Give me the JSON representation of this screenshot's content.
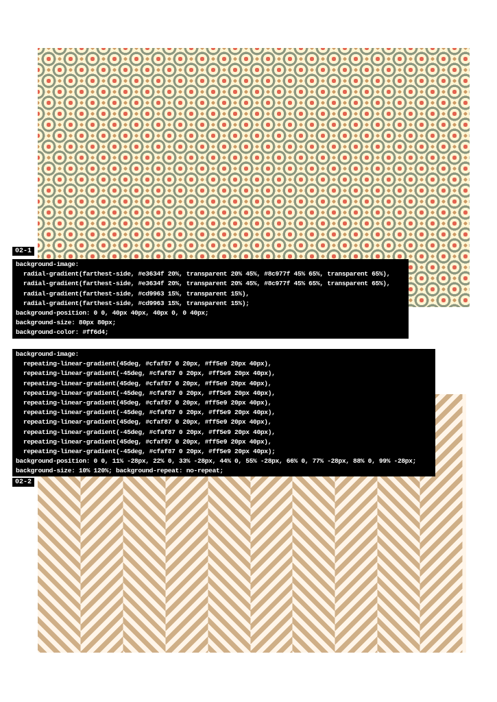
{
  "sections": [
    {
      "label": "02-1",
      "code_lines": [
        "background-image:",
        "  radial-gradient(farthest-side, #e3634f 20%, transparent 20% 45%, #8c977f 45% 65%, transparent 65%),",
        "  radial-gradient(farthest-side, #e3634f 20%, transparent 20% 45%, #8c977f 45% 65%, transparent 65%),",
        "  radial-gradient(farthest-side, #cd9963 15%, transparent 15%),",
        "  radial-gradient(farthest-side, #cd9963 15%, transparent 15%);",
        "background-position: 0 0, 40px 40px, 40px 0, 0 40px;",
        "background-size: 80px 80px;",
        "background-color: #ff6d4;"
      ],
      "colors": [
        "#e3634f",
        "#8c977f",
        "#cd9963",
        "#fff6d4"
      ]
    },
    {
      "label": "02-2",
      "code_lines": [
        "background-image:",
        "  repeating-linear-gradient(45deg, #cfaf87 0 20px, #ff5e9 20px 40px),",
        "  repeating-linear-gradient(-45deg, #cfaf87 0 20px, #ff5e9 20px 40px),",
        "  repeating-linear-gradient(45deg, #cfaf87 0 20px, #ff5e9 20px 40px),",
        "  repeating-linear-gradient(-45deg, #cfaf87 0 20px, #ff5e9 20px 40px),",
        "  repeating-linear-gradient(45deg, #cfaf87 0 20px, #ff5e9 20px 40px),",
        "  repeating-linear-gradient(-45deg, #cfaf87 0 20px, #ff5e9 20px 40px),",
        "  repeating-linear-gradient(45deg, #cfaf87 0 20px, #ff5e9 20px 40px),",
        "  repeating-linear-gradient(-45deg, #cfaf87 0 20px, #ff5e9 20px 40px),",
        "  repeating-linear-gradient(45deg, #cfaf87 0 20px, #ff5e9 20px 40px),",
        "  repeating-linear-gradient(-45deg, #cfaf87 0 20px, #ff5e9 20px 40px);",
        "background-position: 0 0, 11% -28px, 22% 0, 33% -28px, 44% 0, 55% -28px, 66% 0, 77% -28px, 88% 0, 99% -28px;",
        "background-size: 10% 120%; background-repeat: no-repeat;"
      ],
      "colors": [
        "#cfaf87",
        "#fff5e9"
      ]
    }
  ]
}
